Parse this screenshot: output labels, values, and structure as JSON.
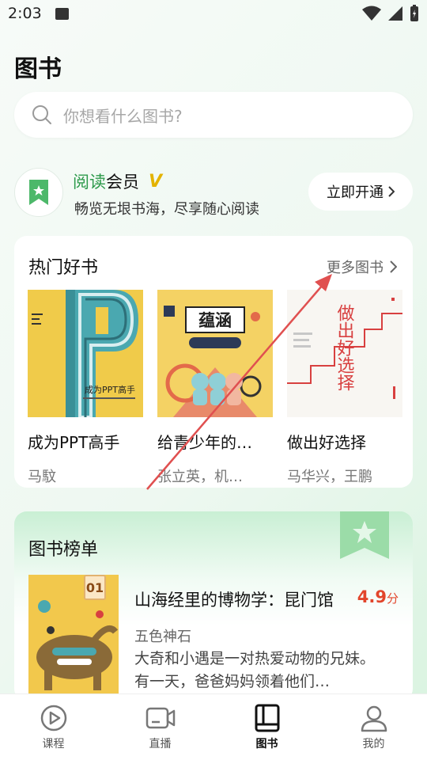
{
  "status_bar": {
    "time": "2:03"
  },
  "page": {
    "title": "图书"
  },
  "search": {
    "placeholder": "你想看什么图书?"
  },
  "member": {
    "title_green": "阅读",
    "title_rest": "会员",
    "vip_badge": "V",
    "subtitle": "畅览无垠书海，尽享随心阅读",
    "open_button": "立即开通"
  },
  "hot_books": {
    "title": "热门好书",
    "more": "更多图书",
    "items": [
      {
        "title": "成为PPT高手",
        "author": "马馼",
        "cover_text": "成为PPT高手"
      },
      {
        "title": "给青少年的…",
        "author": "张立英，机…",
        "cover_text": "蕴涵"
      },
      {
        "title": "做出好选择",
        "author": "马华兴，王鹏",
        "cover_text": "做出好选择"
      }
    ]
  },
  "ranking": {
    "title": "图书榜单",
    "items": [
      {
        "rank": "01",
        "title": "山海经里的博物学：昆门馆",
        "score": "4.9",
        "score_unit": "分",
        "author": "五色神石",
        "description": "大奇和小遇是一对热爱动物的兄妹。有一天，爸爸妈妈领着他们…"
      }
    ]
  },
  "bottom_nav": {
    "items": [
      {
        "label": "课程",
        "icon": "play-circle-icon"
      },
      {
        "label": "直播",
        "icon": "video-icon"
      },
      {
        "label": "图书",
        "icon": "book-icon",
        "active": true
      },
      {
        "label": "我的",
        "icon": "person-icon"
      }
    ]
  },
  "colors": {
    "accent_green": "#2d9a4b",
    "vip_gold": "#e3b300",
    "score_red": "#e2452b",
    "annotation_arrow": "#e05050"
  }
}
